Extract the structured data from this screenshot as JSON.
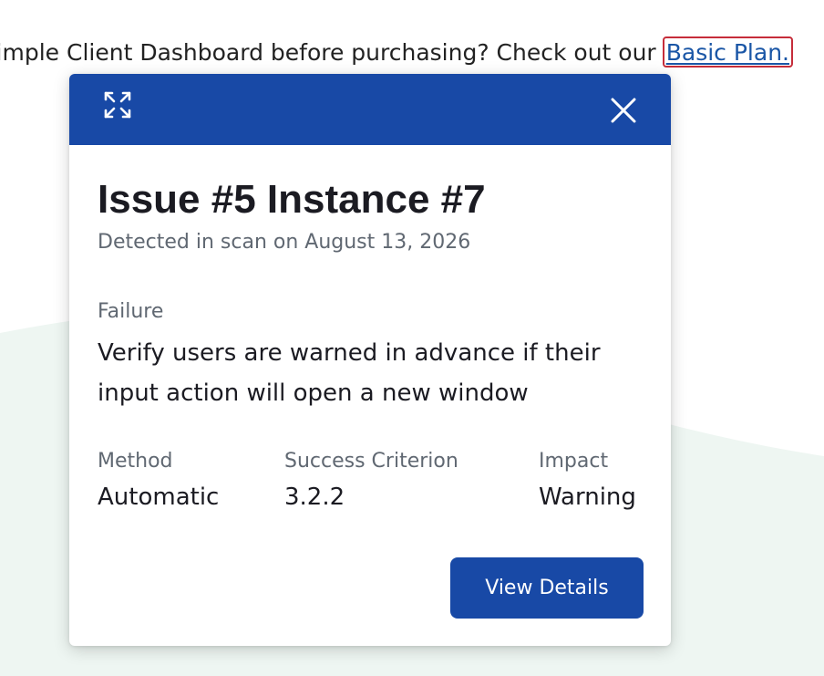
{
  "intro": {
    "text": "; Simple Client Dashboard before purchasing? Check out our",
    "link_label": "Basic Plan."
  },
  "modal": {
    "header": {
      "expand_icon": "expand-arrows-icon",
      "close_icon": "close-icon"
    },
    "title": "Issue #5 Instance #7",
    "detected": "Detected in scan on August 13, 2026",
    "failure_label": "Failure",
    "failure_text": "Verify users are warned in advance if their input action will open a new window",
    "meta": [
      {
        "label": "Method",
        "value": "Automatic"
      },
      {
        "label": "Success Criterion",
        "value": "3.2.2"
      },
      {
        "label": "Impact",
        "value": "Warning"
      }
    ],
    "view_details_label": "View Details"
  },
  "colors": {
    "header_bg": "#1849a6",
    "button_bg": "#1849a6",
    "link": "#1a56a6",
    "focus_outline": "#c62d3a",
    "wave": "#eef6f2"
  }
}
